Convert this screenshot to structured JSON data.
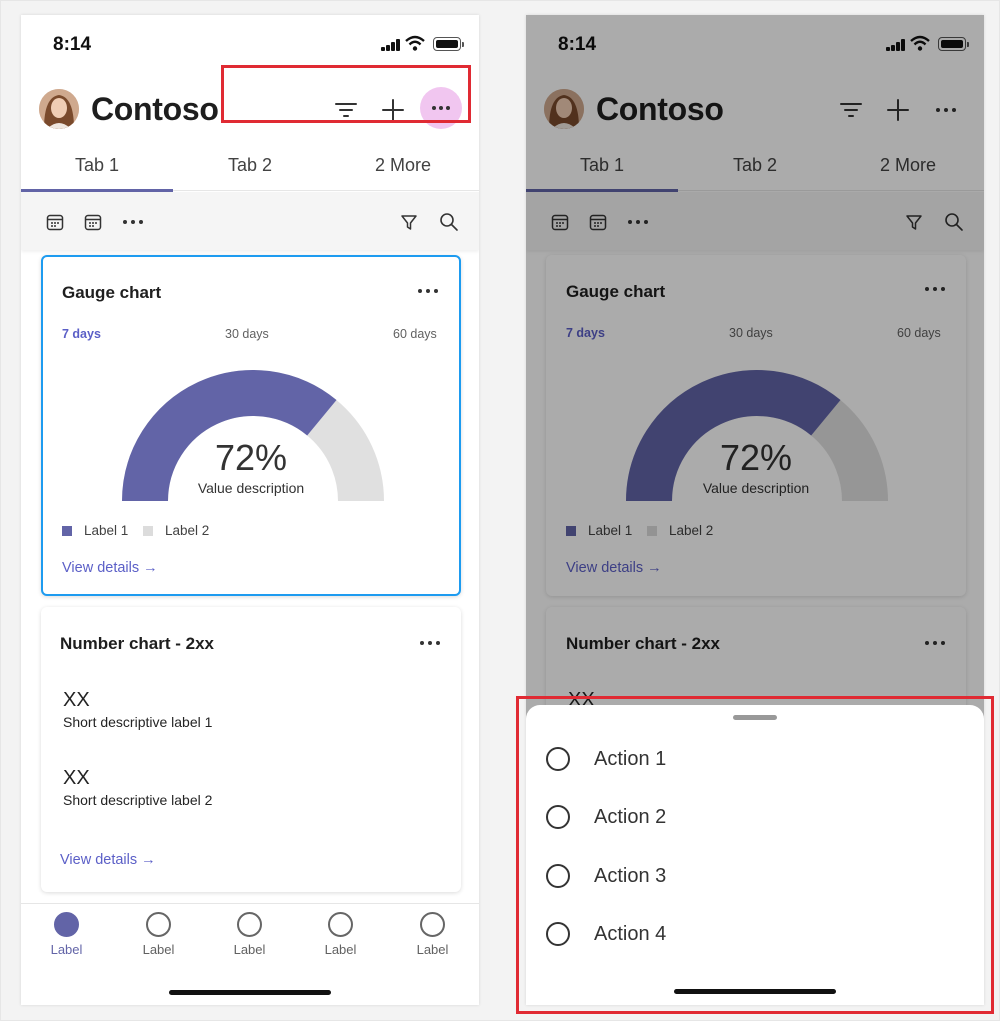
{
  "status_bar": {
    "time": "8:14"
  },
  "header": {
    "title": "Contoso"
  },
  "tabs": [
    "Tab 1",
    "Tab 2",
    "2 More"
  ],
  "gauge_card": {
    "title": "Gauge chart",
    "periods": [
      "7 days",
      "30 days",
      "60 days"
    ],
    "value": "72%",
    "value_fraction": 0.72,
    "description": "Value description",
    "legend": [
      "Label 1",
      "Label 2"
    ],
    "link": "View details →",
    "colors": {
      "series1": "#6264a7",
      "series2": "#e0e0e0",
      "series1_dim": "#42447a",
      "series2_dim": "#969696"
    }
  },
  "number_card": {
    "title": "Number chart - 2xx",
    "items": [
      {
        "value": "XX",
        "label": "Short descriptive label 1"
      },
      {
        "value": "XX",
        "label": "Short descriptive label 2"
      }
    ],
    "link": "View details →"
  },
  "bottom_nav": [
    "Label",
    "Label",
    "Label",
    "Label",
    "Label"
  ],
  "action_sheet": [
    "Action 1",
    "Action 2",
    "Action 3",
    "Action 4"
  ],
  "colors": {
    "accent": "#6264a7",
    "highlight": "#e02a33",
    "selected_border": "#1d9bf0",
    "more_button_highlight": "#f1c6f0"
  }
}
